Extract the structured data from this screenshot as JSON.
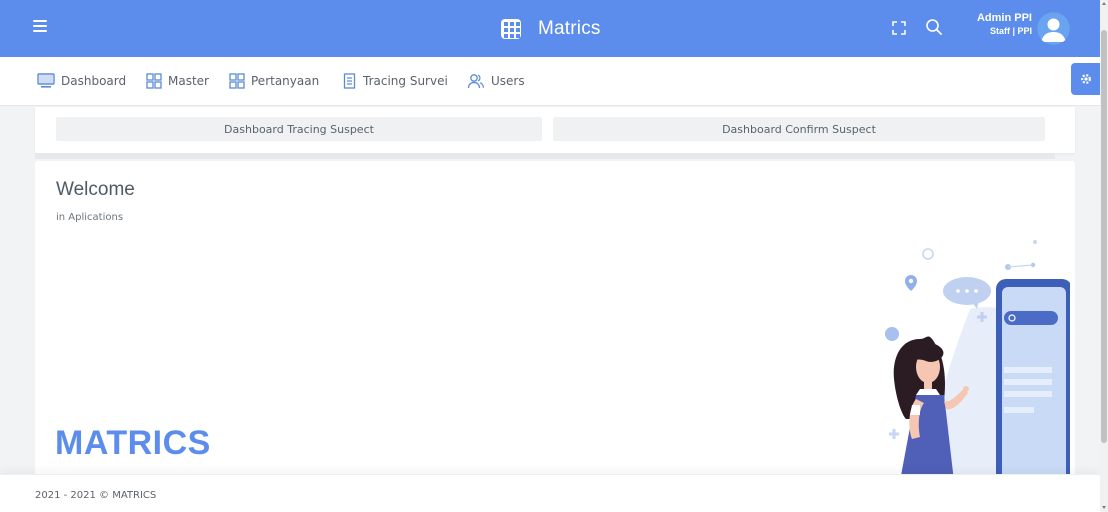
{
  "header": {
    "brand_name": "Matrics",
    "user_name": "Admin PPI",
    "user_role": "Staff | PPI",
    "icons": [
      "menu-icon",
      "grid-logo-icon",
      "fullscreen-icon",
      "search-icon",
      "avatar"
    ],
    "color": "#5c8ded"
  },
  "nav": {
    "items": [
      {
        "label": "Dashboard",
        "icon": "monitor-icon"
      },
      {
        "label": "Master",
        "icon": "grid-icon"
      },
      {
        "label": "Pertanyaan",
        "icon": "grid-icon"
      },
      {
        "label": "Tracing Survei",
        "icon": "document-icon"
      },
      {
        "label": "Users",
        "icon": "users-icon"
      }
    ],
    "settings_icon": "gear-icon"
  },
  "dashboard_buttons": {
    "tracing": "Dashboard Tracing Suspect",
    "confirm": "Dashboard Confirm Suspect"
  },
  "welcome": {
    "title": "Welcome",
    "subtitle": "in Aplications",
    "brand": "MATRICS"
  },
  "footer": {
    "text": "2021 - 2021 © MATRICS"
  }
}
